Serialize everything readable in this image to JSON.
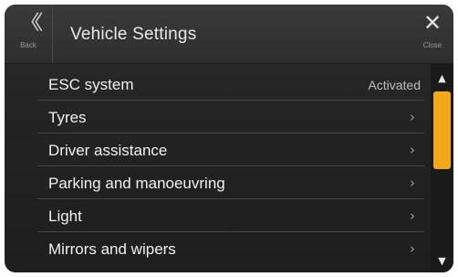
{
  "header": {
    "title": "Vehicle Settings",
    "back": {
      "label": "Back",
      "icon": "double-chevron-left-icon"
    },
    "close": {
      "label": "Close",
      "icon": "close-icon"
    }
  },
  "menu": {
    "items": [
      {
        "label": "ESC system",
        "value": "Activated"
      },
      {
        "label": "Tyres",
        "value": "",
        "chevron": "›"
      },
      {
        "label": "Driver assistance",
        "value": "",
        "chevron": "›"
      },
      {
        "label": "Parking and manoeuvring",
        "value": "",
        "chevron": "›"
      },
      {
        "label": "Light",
        "value": "",
        "chevron": "›"
      },
      {
        "label": "Mirrors and wipers",
        "value": "",
        "chevron": "›"
      }
    ]
  },
  "scrollbar": {
    "up_glyph": "▲",
    "down_glyph": "▼",
    "thumb_color": "#f2a818",
    "visible_fraction": 0.5
  }
}
